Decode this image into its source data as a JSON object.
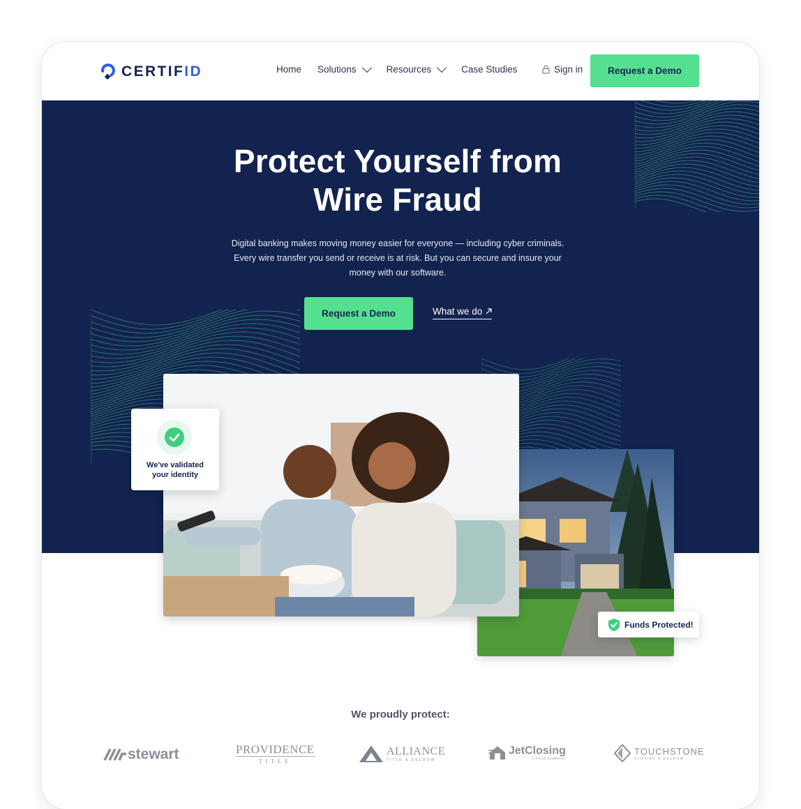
{
  "brand": {
    "name_part1": "CERTIF",
    "name_part2": "ID",
    "primary_color": "#13234f",
    "accent_color": "#55e08f",
    "logo_blue": "#2f5fe0"
  },
  "nav": {
    "items": [
      {
        "label": "Home",
        "has_dropdown": false
      },
      {
        "label": "Solutions",
        "has_dropdown": true
      },
      {
        "label": "Resources",
        "has_dropdown": true
      },
      {
        "label": "Case Studies",
        "has_dropdown": false
      }
    ],
    "signin_label": "Sign in",
    "cta_label": "Request a Demo"
  },
  "hero": {
    "title_line1": "Protect Yourself from",
    "title_line2": "Wire Fraud",
    "subtitle_line1": "Digital banking makes moving money easier for everyone — including cyber criminals.",
    "subtitle_line2": "Every wire transfer you send or receive is at risk. But you can secure and insure your",
    "subtitle_line3": "money with our software.",
    "primary_cta": "Request a Demo",
    "secondary_cta": "What we do"
  },
  "badges": {
    "validated_line1": "We've validated",
    "validated_line2": "your identity",
    "funds": "Funds Protected!"
  },
  "partners": {
    "heading": "We proudly protect:",
    "logos": [
      {
        "name": "stewart",
        "icon": "stewart-stripes-icon"
      },
      {
        "name": "PROVIDENCE",
        "sub": "TITLE"
      },
      {
        "name": "ALLIANCE",
        "sub": "TITLE & ESCROW",
        "icon": "alliance-triangle-icon"
      },
      {
        "name": "JetClosing",
        "sub": "A TITLE COMPANY",
        "icon": "jetclosing-house-icon"
      },
      {
        "name": "TOUCHSTONE",
        "sub": "CLOSING & ESCROW",
        "icon": "touchstone-diamond-icon"
      }
    ]
  },
  "icons": {
    "signin": "lock-icon",
    "external_link": "arrow-up-right-icon",
    "validated": "check-circle-icon",
    "funds": "shield-check-icon"
  }
}
